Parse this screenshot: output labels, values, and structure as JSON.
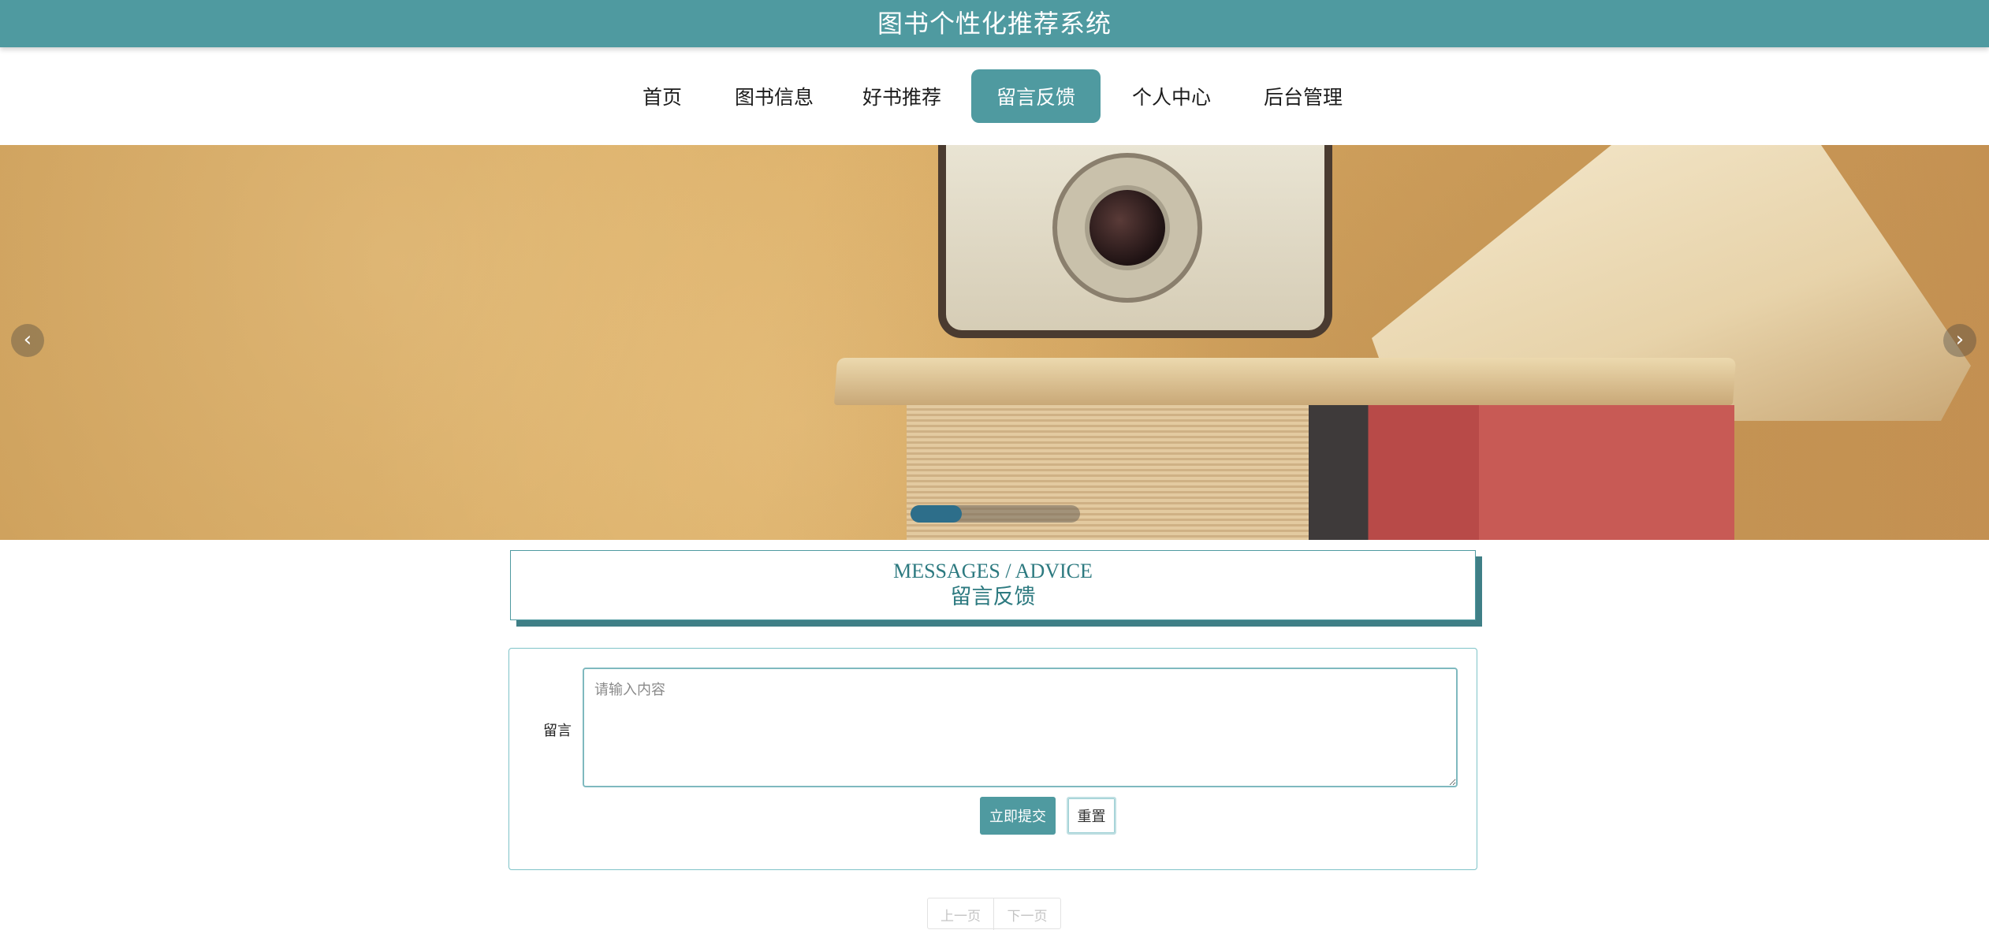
{
  "header": {
    "title": "图书个性化推荐系统"
  },
  "nav": {
    "items": [
      "首页",
      "图书信息",
      "好书推荐",
      "留言反馈",
      "个人中心",
      "后台管理"
    ],
    "active": "留言反馈"
  },
  "carousel": {
    "prev_symbol": "‹",
    "next_symbol": "›",
    "progress": 0.3
  },
  "section_title": {
    "en": "MESSAGES / ADVICE",
    "cn": "留言反馈"
  },
  "form": {
    "label": "留言",
    "placeholder": "请输入内容",
    "submit_label": "立即提交",
    "reset_label": "重置"
  },
  "pagination": {
    "prev_label": "上一页",
    "next_label": "下一页"
  },
  "colors": {
    "primary": "#4f9aa0",
    "title_text": "#2d7a80",
    "carousel_fill": "#2d6e8a"
  }
}
